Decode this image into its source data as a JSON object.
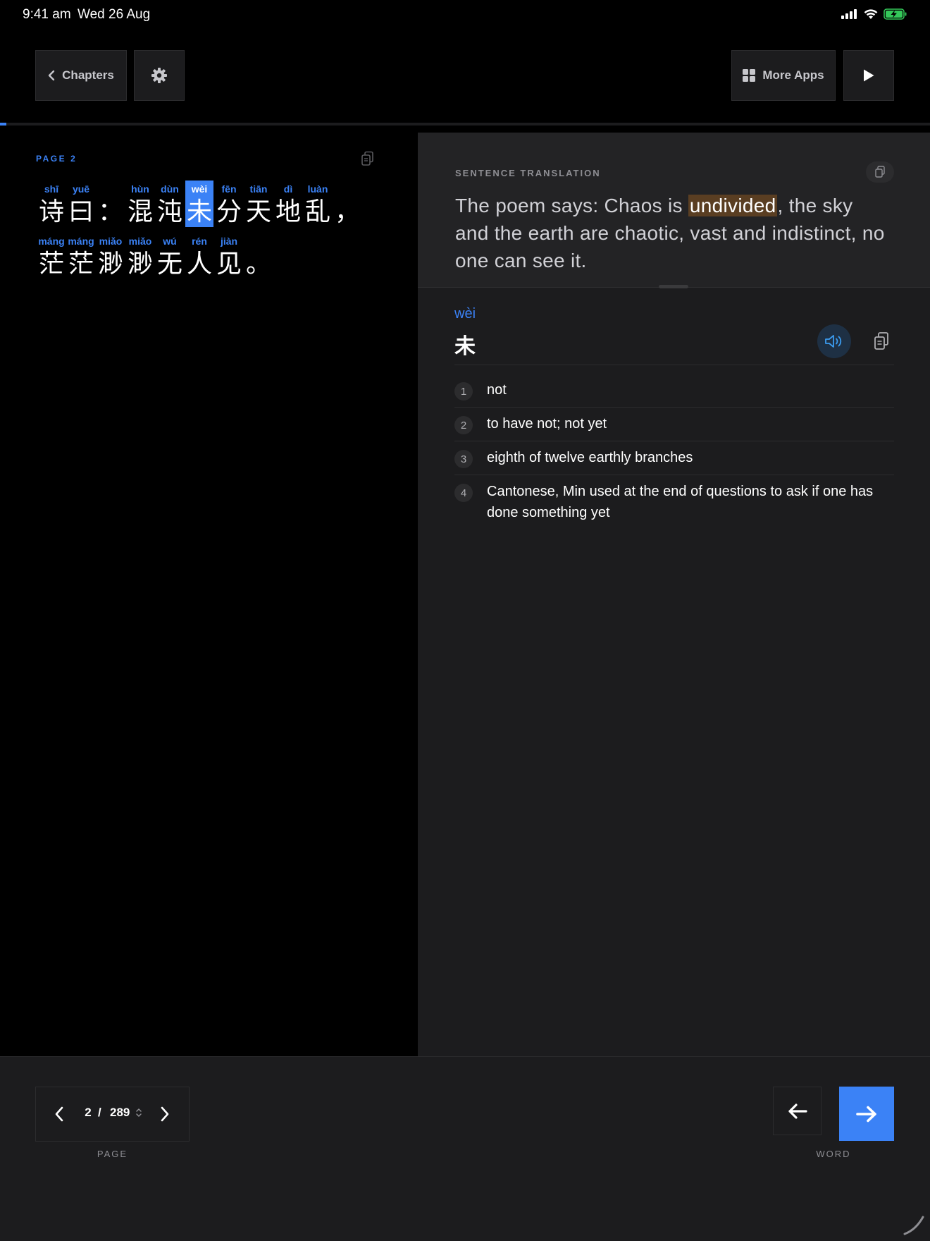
{
  "status_bar": {
    "time": "9:41 am",
    "date": "Wed 26 Aug"
  },
  "toolbar": {
    "chapters_label": "Chapters",
    "more_apps_label": "More Apps"
  },
  "reader": {
    "page_label": "PAGE",
    "page_number": "2",
    "progress_fraction": 0.007,
    "lines": [
      [
        {
          "py": "shī",
          "hz": "诗"
        },
        {
          "py": "yuē",
          "hz": "曰"
        },
        {
          "py": "",
          "hz": "："
        },
        {
          "py": "hùn",
          "hz": "混"
        },
        {
          "py": "dùn",
          "hz": "沌"
        },
        {
          "py": "wèi",
          "hz": "未",
          "selected": true
        },
        {
          "py": "fēn",
          "hz": "分"
        },
        {
          "py": "tiān",
          "hz": "天"
        },
        {
          "py": "dì",
          "hz": "地"
        },
        {
          "py": "luàn",
          "hz": "乱"
        },
        {
          "py": "",
          "hz": "，"
        }
      ],
      [
        {
          "py": "máng",
          "hz": "茫"
        },
        {
          "py": "máng",
          "hz": "茫"
        },
        {
          "py": "miǎo",
          "hz": "渺"
        },
        {
          "py": "miǎo",
          "hz": "渺"
        },
        {
          "py": "wú",
          "hz": "无"
        },
        {
          "py": "rén",
          "hz": "人"
        },
        {
          "py": "jiàn",
          "hz": "见"
        },
        {
          "py": "",
          "hz": "。"
        }
      ]
    ]
  },
  "translation": {
    "label": "SENTENCE TRANSLATION",
    "text_before": "The poem says: Chaos is ",
    "highlight": "undivided",
    "text_after": ", the sky and the earth are chaotic, vast and indistinct, no one can see it."
  },
  "word": {
    "pinyin": "wèi",
    "hanzi": "未",
    "definitions": [
      {
        "num": "1",
        "text": "not"
      },
      {
        "num": "2",
        "text": "to have not; not yet"
      },
      {
        "num": "3",
        "text": "eighth of twelve earthly branches"
      },
      {
        "num": "4",
        "text": "Cantonese, Min used at the end of questions to ask if one has done something yet"
      }
    ]
  },
  "pager": {
    "current": "2",
    "separator": "/",
    "total": "289",
    "caption": "PAGE"
  },
  "word_nav": {
    "caption": "WORD"
  },
  "colors": {
    "accent": "#3b82f6",
    "highlight_bg": "#5a3e22",
    "panel": "#1c1c1e"
  }
}
